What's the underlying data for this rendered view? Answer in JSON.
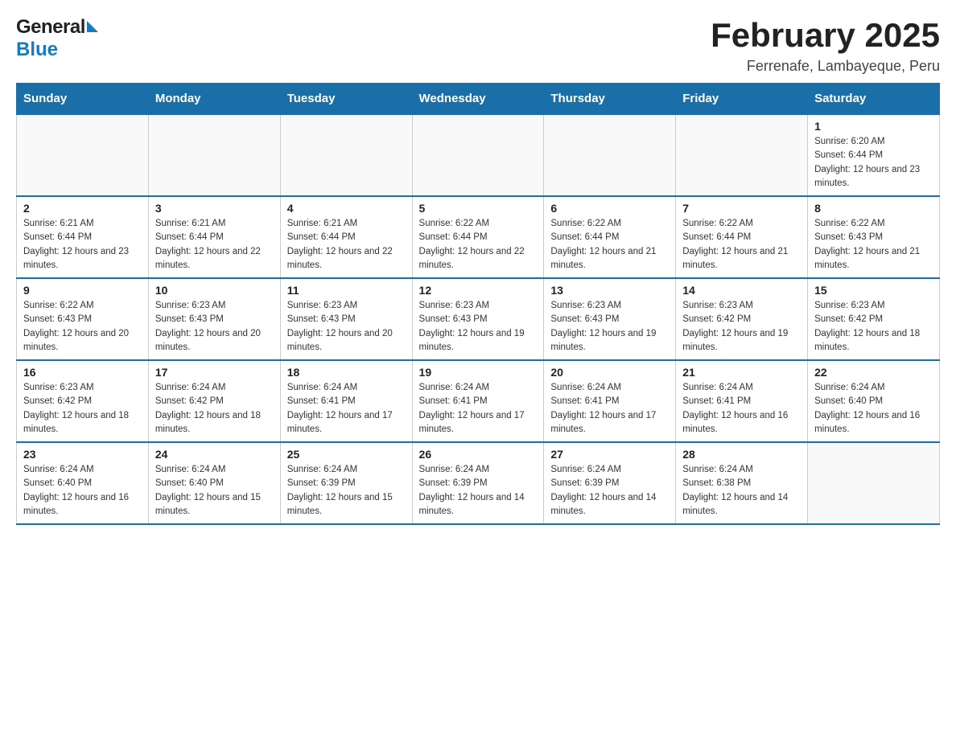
{
  "header": {
    "logo_general": "General",
    "logo_blue": "Blue",
    "title": "February 2025",
    "subtitle": "Ferrenafe, Lambayeque, Peru"
  },
  "days_of_week": [
    "Sunday",
    "Monday",
    "Tuesday",
    "Wednesday",
    "Thursday",
    "Friday",
    "Saturday"
  ],
  "weeks": [
    {
      "days": [
        {
          "number": "",
          "info": ""
        },
        {
          "number": "",
          "info": ""
        },
        {
          "number": "",
          "info": ""
        },
        {
          "number": "",
          "info": ""
        },
        {
          "number": "",
          "info": ""
        },
        {
          "number": "",
          "info": ""
        },
        {
          "number": "1",
          "info": "Sunrise: 6:20 AM\nSunset: 6:44 PM\nDaylight: 12 hours and 23 minutes."
        }
      ]
    },
    {
      "days": [
        {
          "number": "2",
          "info": "Sunrise: 6:21 AM\nSunset: 6:44 PM\nDaylight: 12 hours and 23 minutes."
        },
        {
          "number": "3",
          "info": "Sunrise: 6:21 AM\nSunset: 6:44 PM\nDaylight: 12 hours and 22 minutes."
        },
        {
          "number": "4",
          "info": "Sunrise: 6:21 AM\nSunset: 6:44 PM\nDaylight: 12 hours and 22 minutes."
        },
        {
          "number": "5",
          "info": "Sunrise: 6:22 AM\nSunset: 6:44 PM\nDaylight: 12 hours and 22 minutes."
        },
        {
          "number": "6",
          "info": "Sunrise: 6:22 AM\nSunset: 6:44 PM\nDaylight: 12 hours and 21 minutes."
        },
        {
          "number": "7",
          "info": "Sunrise: 6:22 AM\nSunset: 6:44 PM\nDaylight: 12 hours and 21 minutes."
        },
        {
          "number": "8",
          "info": "Sunrise: 6:22 AM\nSunset: 6:43 PM\nDaylight: 12 hours and 21 minutes."
        }
      ]
    },
    {
      "days": [
        {
          "number": "9",
          "info": "Sunrise: 6:22 AM\nSunset: 6:43 PM\nDaylight: 12 hours and 20 minutes."
        },
        {
          "number": "10",
          "info": "Sunrise: 6:23 AM\nSunset: 6:43 PM\nDaylight: 12 hours and 20 minutes."
        },
        {
          "number": "11",
          "info": "Sunrise: 6:23 AM\nSunset: 6:43 PM\nDaylight: 12 hours and 20 minutes."
        },
        {
          "number": "12",
          "info": "Sunrise: 6:23 AM\nSunset: 6:43 PM\nDaylight: 12 hours and 19 minutes."
        },
        {
          "number": "13",
          "info": "Sunrise: 6:23 AM\nSunset: 6:43 PM\nDaylight: 12 hours and 19 minutes."
        },
        {
          "number": "14",
          "info": "Sunrise: 6:23 AM\nSunset: 6:42 PM\nDaylight: 12 hours and 19 minutes."
        },
        {
          "number": "15",
          "info": "Sunrise: 6:23 AM\nSunset: 6:42 PM\nDaylight: 12 hours and 18 minutes."
        }
      ]
    },
    {
      "days": [
        {
          "number": "16",
          "info": "Sunrise: 6:23 AM\nSunset: 6:42 PM\nDaylight: 12 hours and 18 minutes."
        },
        {
          "number": "17",
          "info": "Sunrise: 6:24 AM\nSunset: 6:42 PM\nDaylight: 12 hours and 18 minutes."
        },
        {
          "number": "18",
          "info": "Sunrise: 6:24 AM\nSunset: 6:41 PM\nDaylight: 12 hours and 17 minutes."
        },
        {
          "number": "19",
          "info": "Sunrise: 6:24 AM\nSunset: 6:41 PM\nDaylight: 12 hours and 17 minutes."
        },
        {
          "number": "20",
          "info": "Sunrise: 6:24 AM\nSunset: 6:41 PM\nDaylight: 12 hours and 17 minutes."
        },
        {
          "number": "21",
          "info": "Sunrise: 6:24 AM\nSunset: 6:41 PM\nDaylight: 12 hours and 16 minutes."
        },
        {
          "number": "22",
          "info": "Sunrise: 6:24 AM\nSunset: 6:40 PM\nDaylight: 12 hours and 16 minutes."
        }
      ]
    },
    {
      "days": [
        {
          "number": "23",
          "info": "Sunrise: 6:24 AM\nSunset: 6:40 PM\nDaylight: 12 hours and 16 minutes."
        },
        {
          "number": "24",
          "info": "Sunrise: 6:24 AM\nSunset: 6:40 PM\nDaylight: 12 hours and 15 minutes."
        },
        {
          "number": "25",
          "info": "Sunrise: 6:24 AM\nSunset: 6:39 PM\nDaylight: 12 hours and 15 minutes."
        },
        {
          "number": "26",
          "info": "Sunrise: 6:24 AM\nSunset: 6:39 PM\nDaylight: 12 hours and 14 minutes."
        },
        {
          "number": "27",
          "info": "Sunrise: 6:24 AM\nSunset: 6:39 PM\nDaylight: 12 hours and 14 minutes."
        },
        {
          "number": "28",
          "info": "Sunrise: 6:24 AM\nSunset: 6:38 PM\nDaylight: 12 hours and 14 minutes."
        },
        {
          "number": "",
          "info": ""
        }
      ]
    }
  ]
}
